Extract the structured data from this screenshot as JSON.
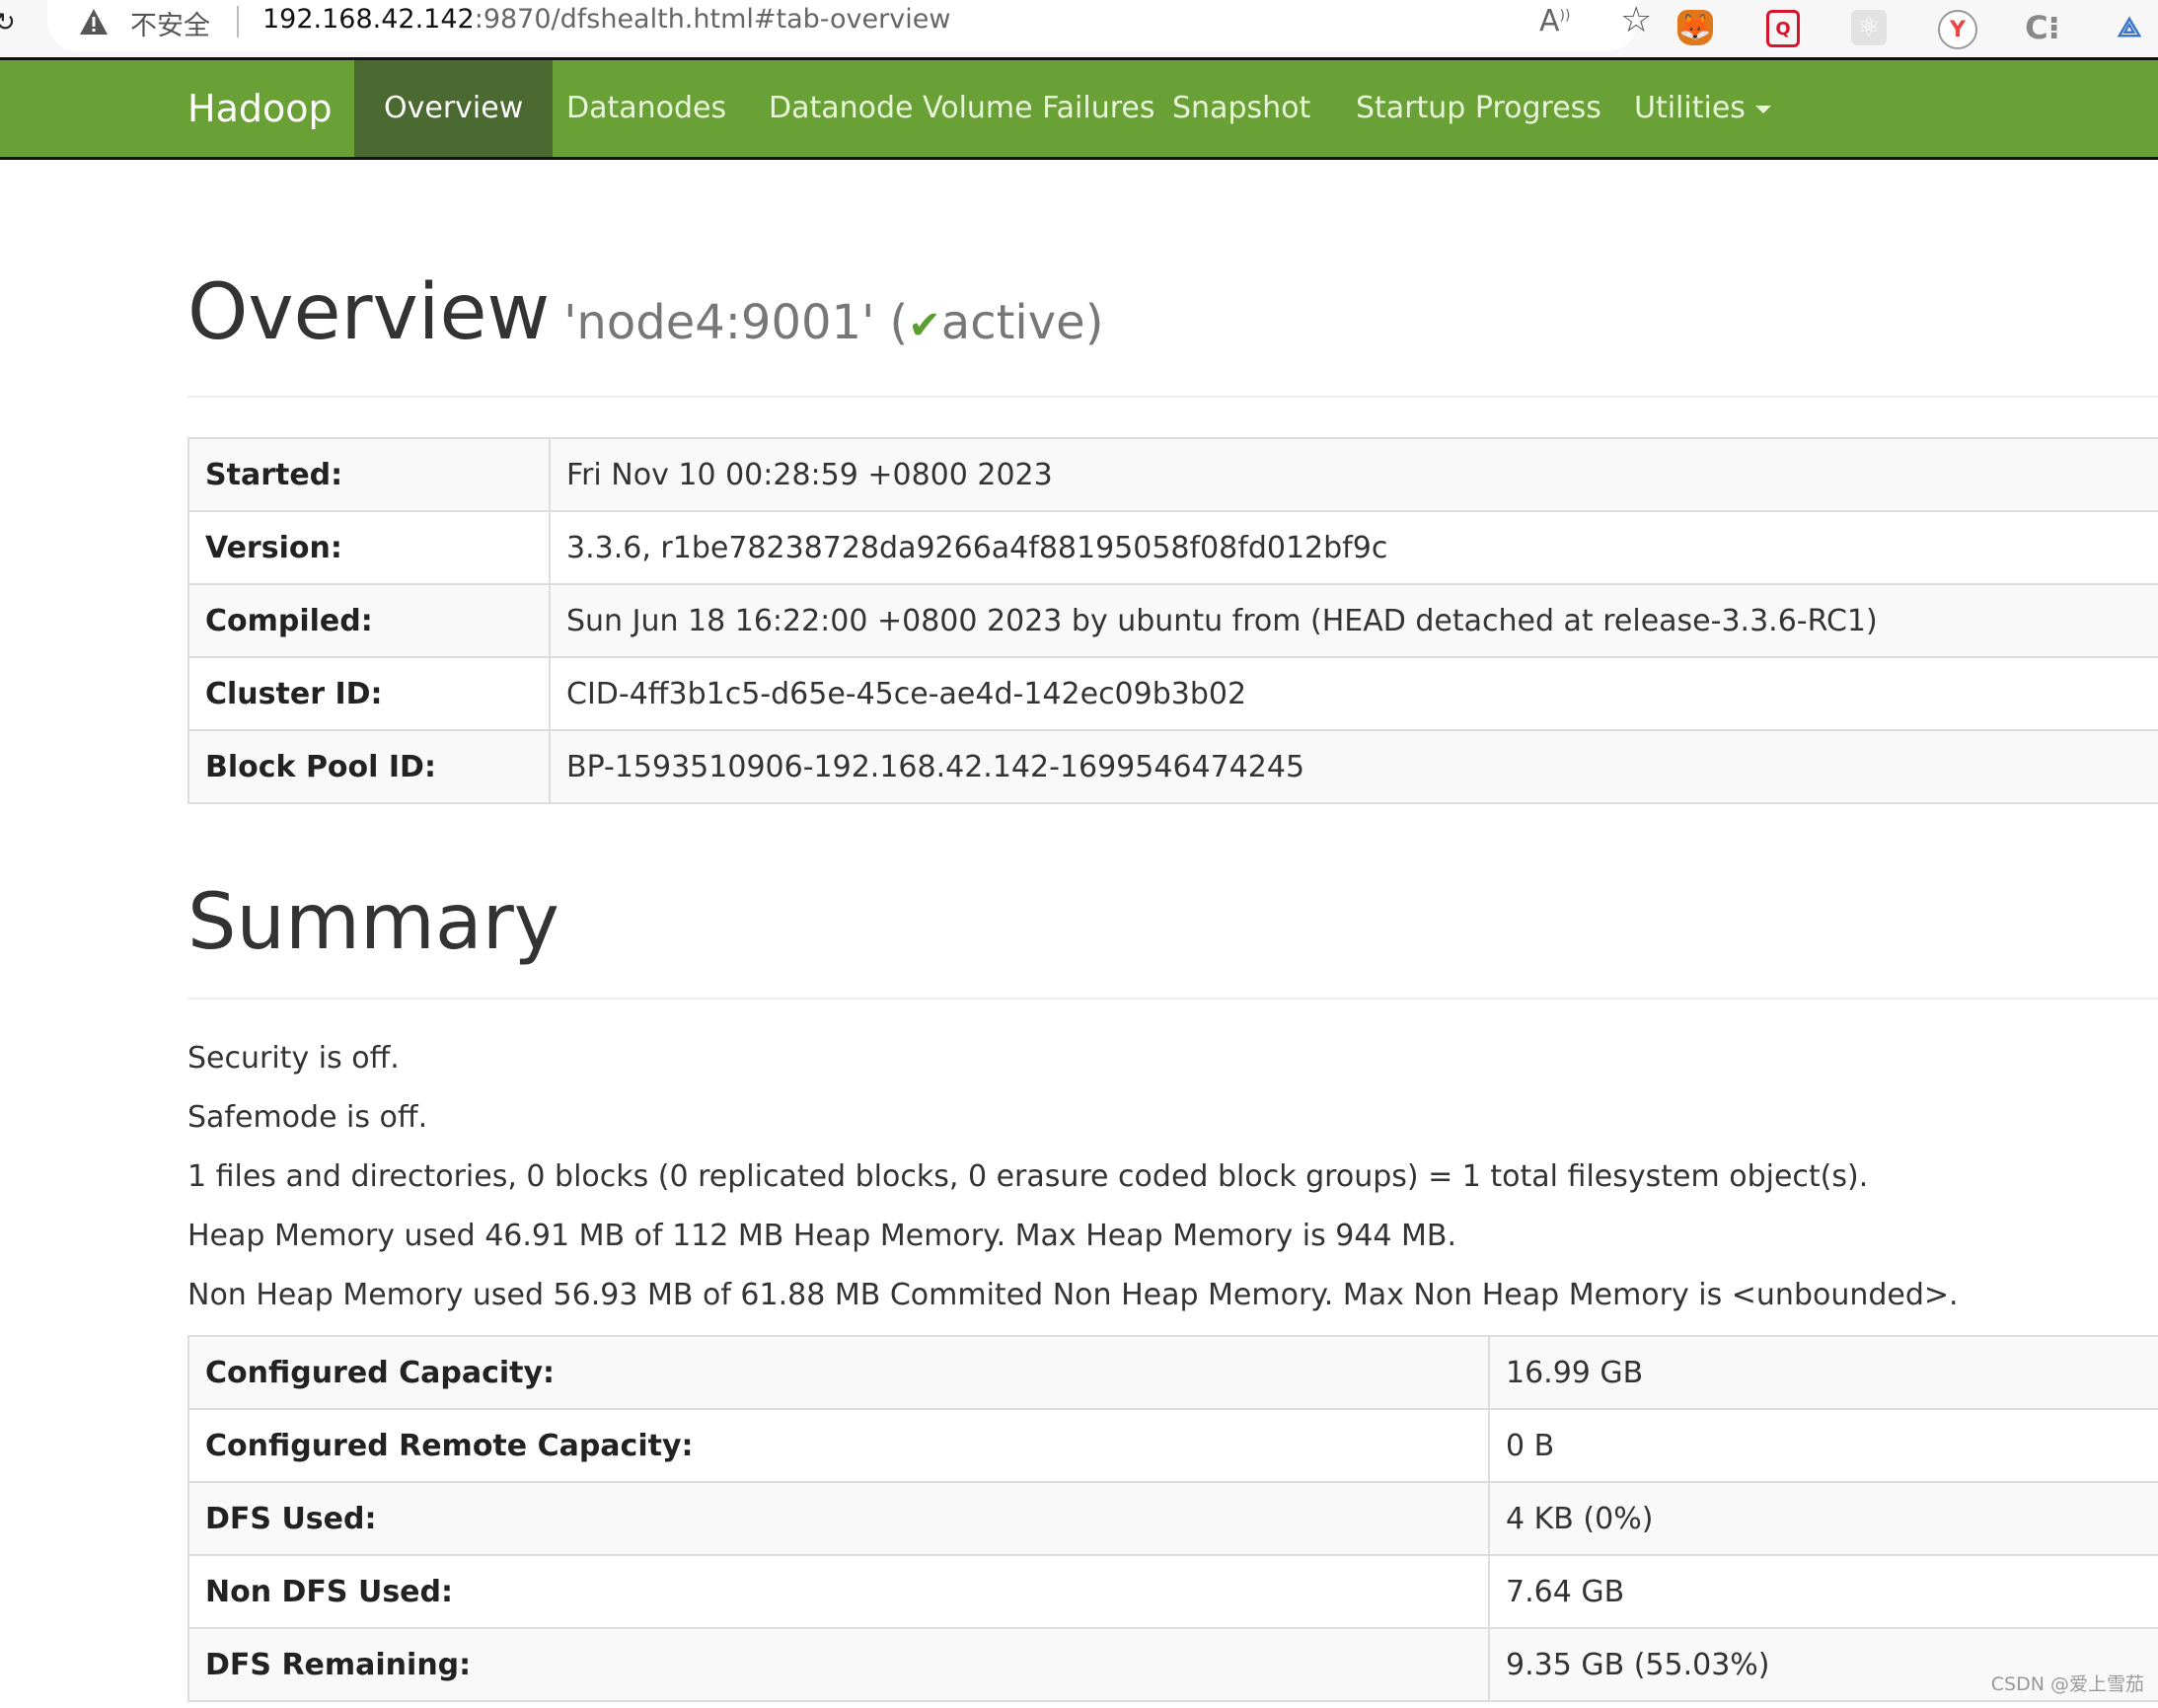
{
  "browser": {
    "security_label": "不安全",
    "url_host": "192.168.42.142",
    "url_rest": ":9870/dfshealth.html#tab-overview",
    "extensions": [
      "metamask-fox",
      "doc-search",
      "react-devtools",
      "y-extension",
      "c-extension",
      "network-extension"
    ]
  },
  "navbar": {
    "brand": "Hadoop",
    "items": [
      {
        "label": "Overview",
        "active": true
      },
      {
        "label": "Datanodes"
      },
      {
        "label": "Datanode Volume Failures"
      },
      {
        "label": "Snapshot"
      },
      {
        "label": "Startup Progress"
      },
      {
        "label": "Utilities",
        "dropdown": true
      }
    ],
    "color": "#6aa136",
    "active_color": "#4a6a31"
  },
  "overview": {
    "title": "Overview",
    "node": "'node4:9001'",
    "status_open": "(",
    "status_icon": "✔",
    "status": "active)",
    "rows": [
      {
        "label": "Started:",
        "value": "Fri Nov 10 00:28:59 +0800 2023"
      },
      {
        "label": "Version:",
        "value": "3.3.6, r1be78238728da9266a4f88195058f08fd012bf9c"
      },
      {
        "label": "Compiled:",
        "value": "Sun Jun 18 16:22:00 +0800 2023 by ubuntu from (HEAD detached at release-3.3.6-RC1)"
      },
      {
        "label": "Cluster ID:",
        "value": "CID-4ff3b1c5-d65e-45ce-ae4d-142ec09b3b02"
      },
      {
        "label": "Block Pool ID:",
        "value": "BP-1593510906-192.168.42.142-1699546474245"
      }
    ]
  },
  "summary": {
    "title": "Summary",
    "lines": [
      "Security is off.",
      "Safemode is off.",
      "1 files and directories, 0 blocks (0 replicated blocks, 0 erasure coded block groups) = 1 total filesystem object(s).",
      "Heap Memory used 46.91 MB of 112 MB Heap Memory. Max Heap Memory is 944 MB.",
      "Non Heap Memory used 56.93 MB of 61.88 MB Commited Non Heap Memory. Max Non Heap Memory is <unbounded>."
    ],
    "rows": [
      {
        "label": "Configured Capacity:",
        "value": "16.99 GB"
      },
      {
        "label": "Configured Remote Capacity:",
        "value": "0 B"
      },
      {
        "label": "DFS Used:",
        "value": "4 KB (0%)"
      },
      {
        "label": "Non DFS Used:",
        "value": "7.64 GB"
      },
      {
        "label": "DFS Remaining:",
        "value": "9.35 GB (55.03%)"
      }
    ]
  },
  "watermark": "CSDN @爱上雪茄"
}
